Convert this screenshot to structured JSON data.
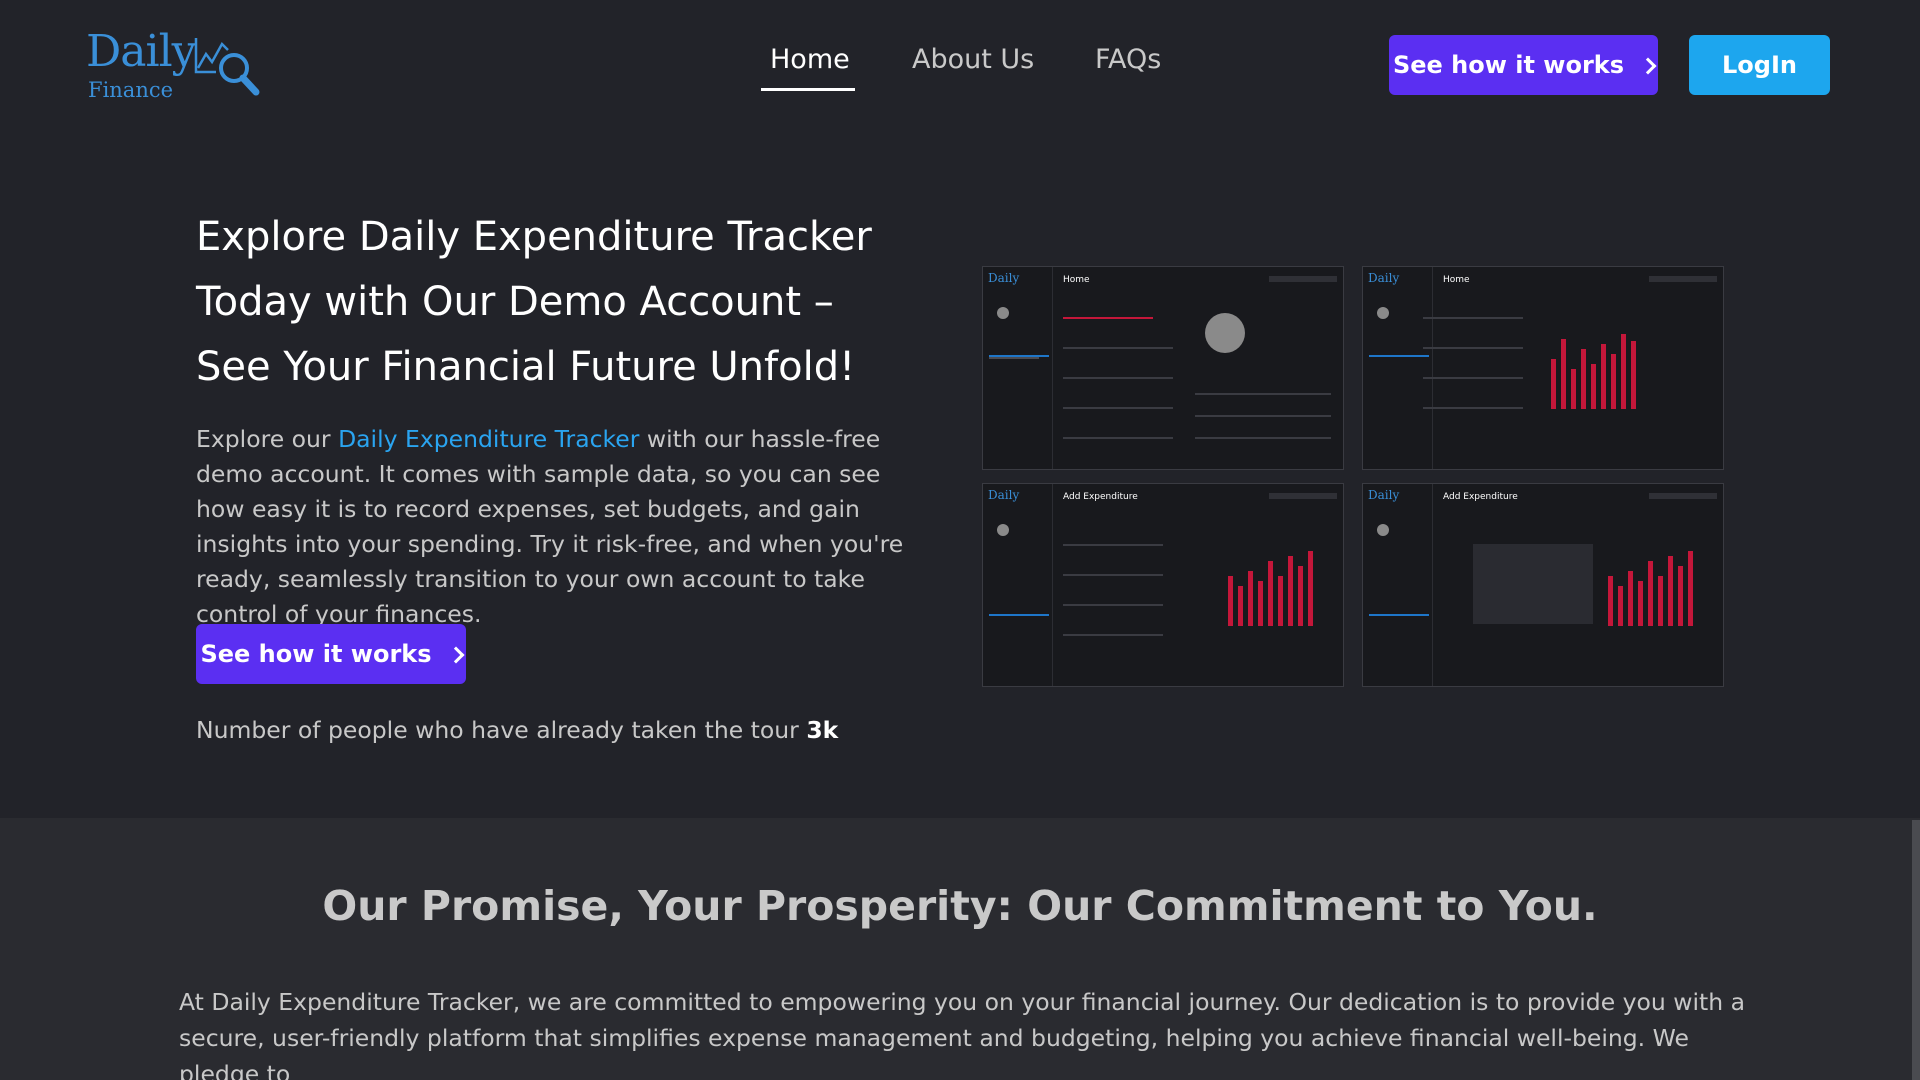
{
  "header": {
    "logo": {
      "word1": "Daily",
      "word2": "Finance"
    },
    "nav": [
      {
        "label": "Home",
        "active": true
      },
      {
        "label": "About Us",
        "active": false
      },
      {
        "label": "FAQs",
        "active": false
      }
    ],
    "cta_label": "See how it works",
    "login_label": "LogIn"
  },
  "hero": {
    "title": "Explore Daily Expenditure Tracker Today with Our Demo Account – See Your Financial Future Unfold!",
    "text_before": "Explore our ",
    "highlight": "Daily Expenditure Tracker",
    "text_after": " with our hassle-free demo account. It comes with sample data, so you can see how easy it is to record expenses, set budgets, and gain insights into your spending. Try it risk-free, and when you're ready, seamlessly transition to your own account to take control of your finances.",
    "cta_label": "See how it works",
    "tour_text": "Number of people who have already taken the tour",
    "tour_count": "3k"
  },
  "screens": [
    {
      "title": "Home"
    },
    {
      "title": "Home"
    },
    {
      "title": "Add Expenditure"
    },
    {
      "title": "Add Expenditure"
    }
  ],
  "promise": {
    "title": "Our Promise, Your Prosperity: Our Commitment to You.",
    "text": "At Daily Expenditure Tracker, we are committed to empowering you on your financial journey. Our dedication is to provide you with a secure, user-friendly platform that simplifies expense management and budgeting, helping you achieve financial well-being. We pledge to"
  },
  "colors": {
    "background": "#222329",
    "accent_purple": "#5b2ff2",
    "accent_blue": "#1da6ee",
    "link": "#2aa4f0",
    "bar_red": "#c4173a"
  },
  "icons": {
    "logo": "chart-magnifier-icon",
    "cta": "chevron-right-icon"
  }
}
